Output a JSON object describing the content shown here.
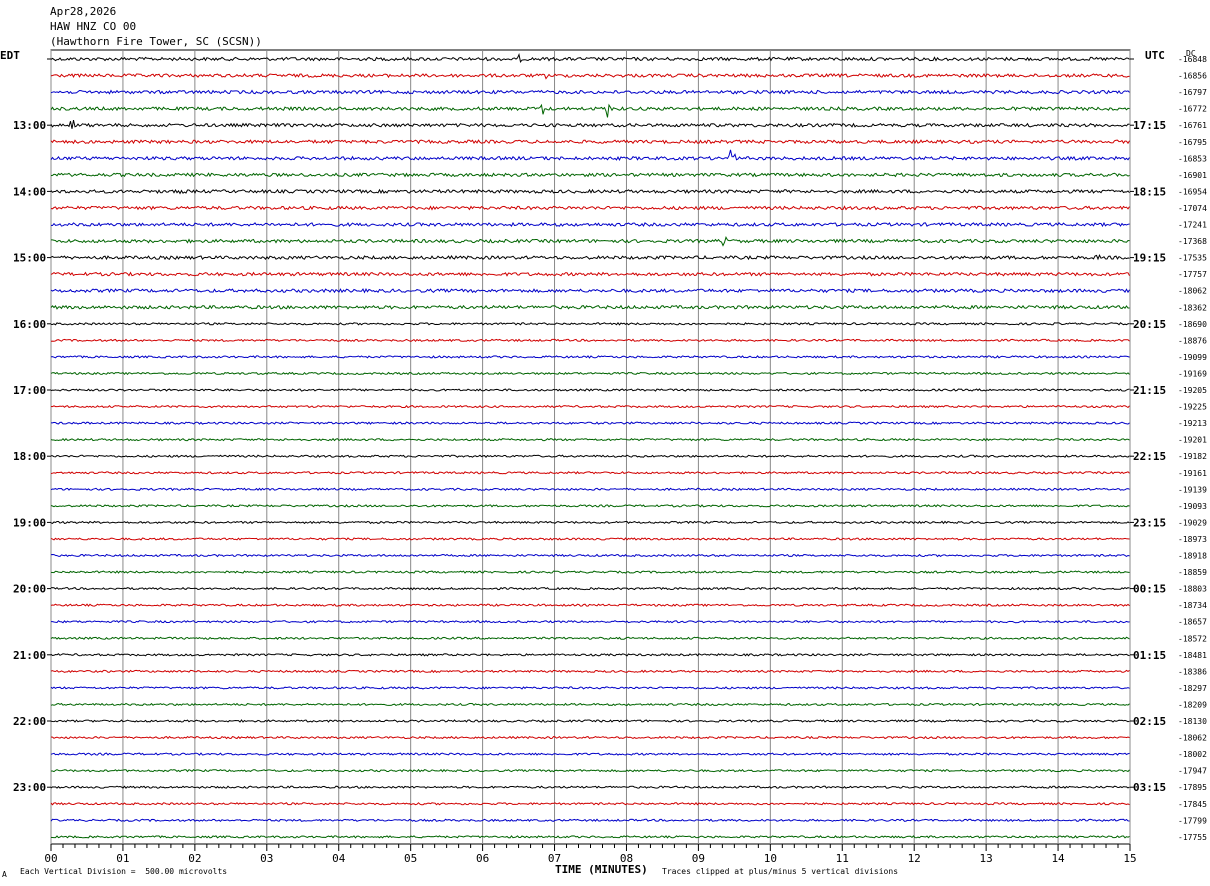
{
  "header": {
    "date": "Apr28,2026",
    "station": "HAW HNZ CO 00",
    "location": "(Hawthorn Fire Tower, SC (SCSN))"
  },
  "left_tz": "EDT",
  "right_tz": "UTC",
  "dc_label": "DC",
  "chart_data": {
    "type": "line",
    "title": "HAW HNZ CO 00",
    "xlabel": "TIME (MINUTES)",
    "x_ticks": [
      "00",
      "01",
      "02",
      "03",
      "04",
      "05",
      "06",
      "07",
      "08",
      "09",
      "10",
      "11",
      "12",
      "13",
      "14",
      "15"
    ],
    "xlim": [
      0,
      15
    ],
    "left_time_labels": [
      "13:00",
      "14:00",
      "15:00",
      "16:00",
      "17:00",
      "18:00",
      "19:00",
      "20:00",
      "21:00",
      "22:00",
      "23:00"
    ],
    "right_time_labels": [
      "17:15",
      "18:15",
      "19:15",
      "20:15",
      "21:15",
      "22:15",
      "23:15",
      "00:15",
      "01:15",
      "02:15",
      "03:15"
    ],
    "trace_colors": [
      "#000000",
      "#d00000",
      "#0000c8",
      "#006400"
    ],
    "dc_offsets": [
      -16848,
      -16856,
      -16797,
      -16772,
      -16761,
      -16795,
      -16853,
      -16901,
      -16954,
      -17074,
      -17241,
      -17368,
      -17535,
      -17757,
      -18062,
      -18362,
      -18690,
      -18876,
      -19099,
      -19169,
      -19205,
      -19225,
      -19213,
      -19201,
      -19182,
      -19161,
      -19139,
      -19093,
      -19029,
      -18973,
      -18918,
      -18859,
      -18803,
      -18734,
      -18657,
      -18572,
      -18481,
      -18386,
      -18297,
      -18209,
      -18130,
      -18062,
      -18002,
      -17947,
      -17895,
      -17845,
      -17799,
      -17755
    ],
    "events": [
      {
        "trace": 0,
        "minute": 6.5,
        "amp": 4
      },
      {
        "trace": 1,
        "minute": 6.9,
        "amp": 5
      },
      {
        "trace": 3,
        "minute": 6.85,
        "amp": 7
      },
      {
        "trace": 3,
        "minute": 7.75,
        "amp": 12
      },
      {
        "trace": 3,
        "minute": 13.95,
        "amp": 4
      },
      {
        "trace": 4,
        "minute": 0.3,
        "amp": 8
      },
      {
        "trace": 6,
        "minute": 9.47,
        "amp": 14
      },
      {
        "trace": 8,
        "minute": 1.8,
        "amp": 3
      },
      {
        "trace": 11,
        "minute": 9.35,
        "amp": 6
      },
      {
        "trace": 12,
        "minute": 14.55,
        "amp": 4
      },
      {
        "trace": 13,
        "minute": 10.55,
        "amp": 4
      }
    ],
    "footer_scale": "Each Vertical Division =  500.00 microvolts",
    "footer_clip": "Traces clipped at plus/minus 5 vertical divisions",
    "corner_mark": "A"
  }
}
